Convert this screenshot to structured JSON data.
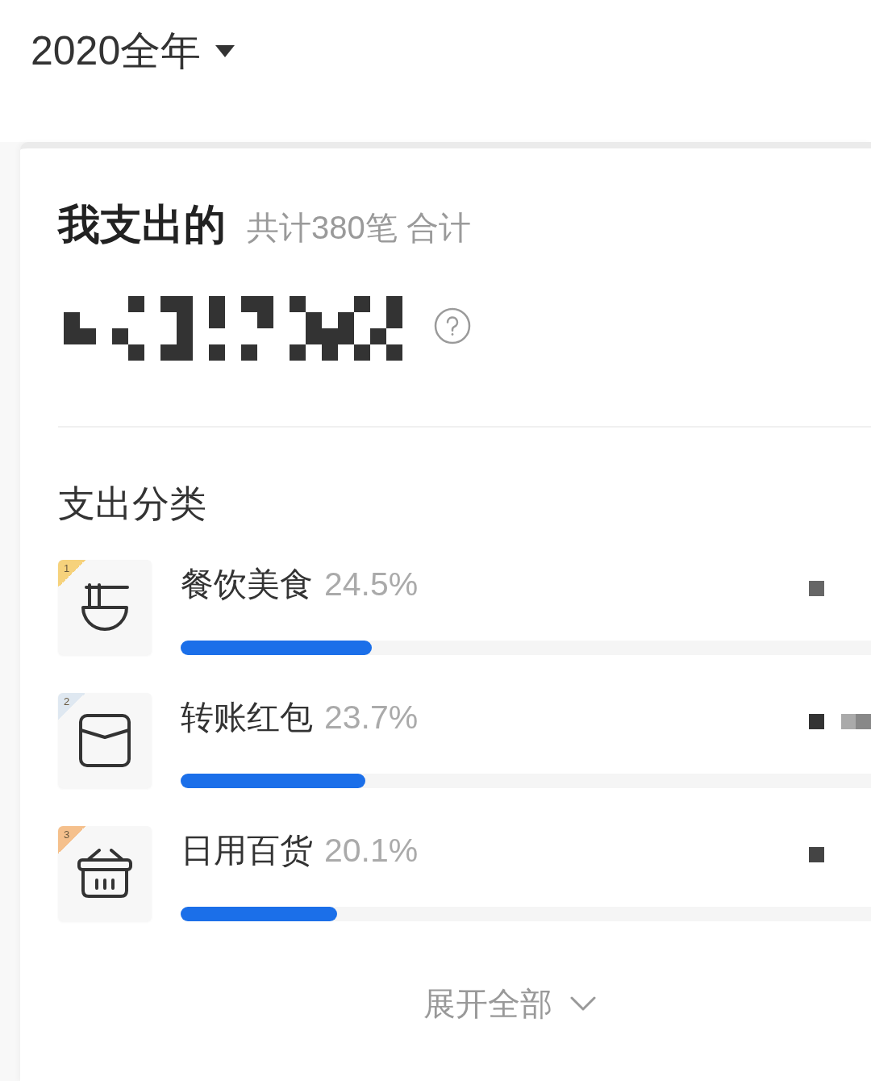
{
  "period_selector": {
    "label": "2020全年"
  },
  "summary": {
    "title": "我支出的",
    "subtitle": "共计380笔 合计"
  },
  "categories_section": {
    "title": "支出分类",
    "items": [
      {
        "rank": "1",
        "color": "#f6d27c",
        "name": "餐饮美食",
        "percent": "24.5%",
        "level": 0.277
      },
      {
        "rank": "2",
        "color": "#dfe8f1",
        "name": "转账红包",
        "percent": "23.7%",
        "level": 0.268
      },
      {
        "rank": "3",
        "color": "#f5c08c",
        "name": "日用百货",
        "percent": "20.1%",
        "level": 0.227
      }
    ]
  },
  "expand_button": {
    "label": "展开全部"
  }
}
